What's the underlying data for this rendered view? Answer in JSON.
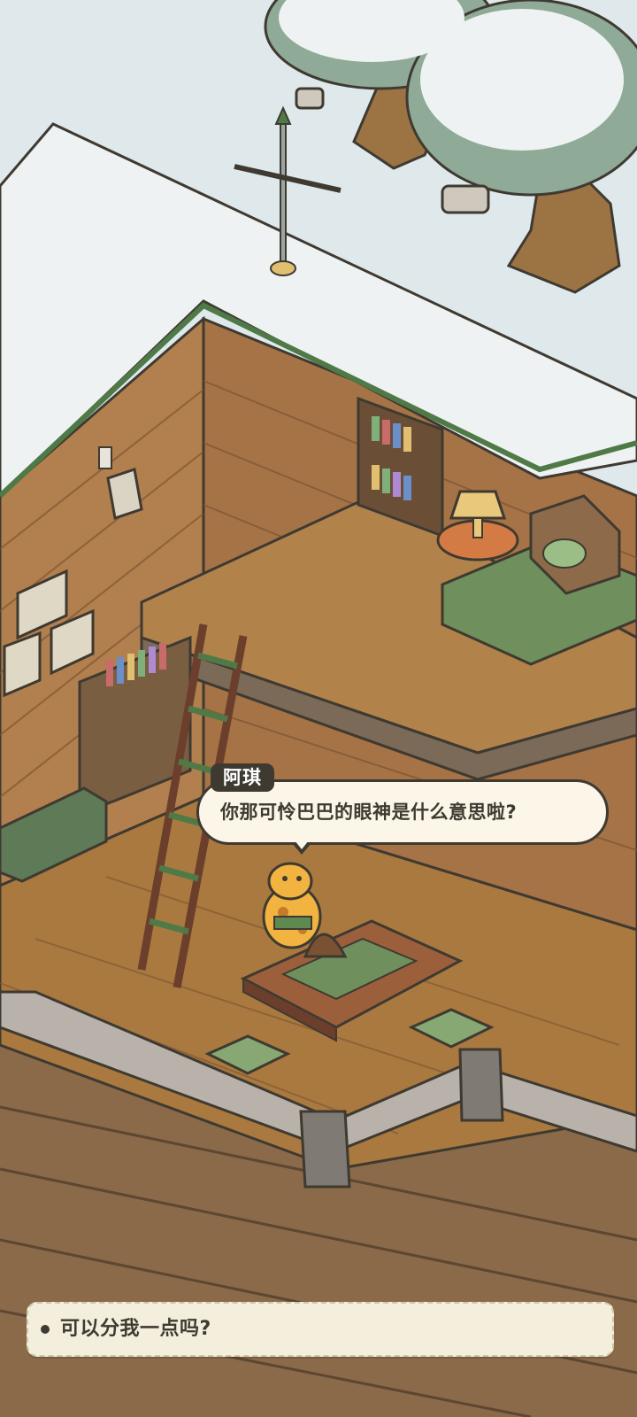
{
  "dialogue": {
    "speaker": "阿琪",
    "text": "你那可怜巴巴的眼神是什么意思啦?"
  },
  "choices": [
    {
      "label": "可以分我一点吗?"
    }
  ],
  "colors": {
    "snow": "#eef2f2",
    "brick": "#b27f4e",
    "floor": "#a9793f",
    "beam": "#7b6a57",
    "green_trim": "#4f7a48",
    "ink": "#3f3a31",
    "bubble": "#fbf6e8"
  }
}
